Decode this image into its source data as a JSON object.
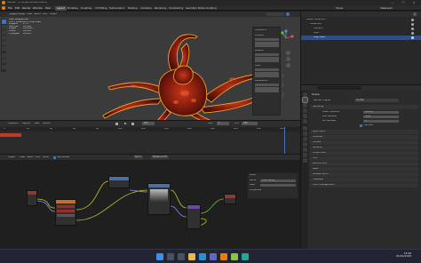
{
  "window": {
    "title": "Blender* [C:\\Projects\\Scene.blend]",
    "controls": [
      "—",
      "☐",
      "✕"
    ]
  },
  "menu": {
    "items": [
      "File",
      "Edit",
      "Render",
      "Window",
      "Help"
    ],
    "workspaces": [
      "Layout",
      "Modeling",
      "Sculpting",
      "UV Editing",
      "Texture Paint",
      "Shading",
      "Animation",
      "Rendering",
      "Compositing",
      "Geometry Nodes",
      "Scripting"
    ],
    "active_workspace": "Layout",
    "scene": "Scene",
    "view_layer": "ViewLayer"
  },
  "viewport": {
    "mode": "Object Mode",
    "header_items": [
      "View",
      "Select",
      "Add",
      "Object"
    ],
    "overlay_title": "User Perspective",
    "overlay_sub": "(237) Collection | Dog Head",
    "stats": [
      {
        "label": "Objects",
        "value": "1 / 1"
      },
      {
        "label": "Vertices",
        "value": "47,816"
      },
      {
        "label": "Edges",
        "value": "143,448"
      },
      {
        "label": "Faces",
        "value": "95,632"
      },
      {
        "label": "Triangles",
        "value": "95,632"
      }
    ],
    "npanel_title": "Transform",
    "npanel_fields": [
      "Location",
      "Rotation",
      "Scale",
      "Dimensions"
    ],
    "npanel_tabs": [
      "Item",
      "Tool",
      "View"
    ],
    "colors": {
      "bg": "#3b3b3b",
      "creature_dark": "#3a0b06",
      "creature_mid": "#7a1a0c",
      "creature_glow": "#d84a28",
      "outline": "#f0a030"
    }
  },
  "outliner": {
    "header": "Scene Collection",
    "items": [
      "Scene Collection",
      "Collection",
      "Camera",
      "Light",
      "Dog Head"
    ],
    "selected": "Dog Head"
  },
  "properties": {
    "title": "Scene",
    "sections": [
      "Render Engine",
      "Sampling",
      "Denoise",
      "Light Paths",
      "Volumes",
      "Curves",
      "Simplify",
      "Motion Blur",
      "Film",
      "Performance",
      "Bake",
      "Grease Pencil",
      "Freestyle",
      "Color Management"
    ],
    "render_engine": "Cycles",
    "fields": [
      {
        "label": "Noise Threshold",
        "value": "0.0100"
      },
      {
        "label": "Max Samples",
        "value": "4096"
      },
      {
        "label": "Min Samples",
        "value": "0"
      }
    ]
  },
  "timeline": {
    "header_items": [
      "Playback",
      "Keying",
      "View",
      "Marker"
    ],
    "frame": "237",
    "start_label": "Start",
    "start": "1",
    "end_label": "End",
    "end": "250",
    "ticks": [
      "0",
      "20",
      "40",
      "60",
      "80",
      "100",
      "120",
      "140",
      "160",
      "180",
      "200",
      "220",
      "240"
    ],
    "current_frame_fraction": 0.948
  },
  "node_editor": {
    "header_items": [
      "Object",
      "View",
      "Select",
      "Add",
      "Node"
    ],
    "use_nodes_label": "Use Nodes",
    "slot": "Slot 1",
    "material": "Material.001",
    "side_title": "Node",
    "side_fields": [
      {
        "label": "Name",
        "value": "Color Ramp"
      },
      {
        "label": "Label",
        "value": ""
      }
    ],
    "side_section": "Properties"
  },
  "taskbar": {
    "time": "12:00",
    "date": "01/01/2023"
  }
}
